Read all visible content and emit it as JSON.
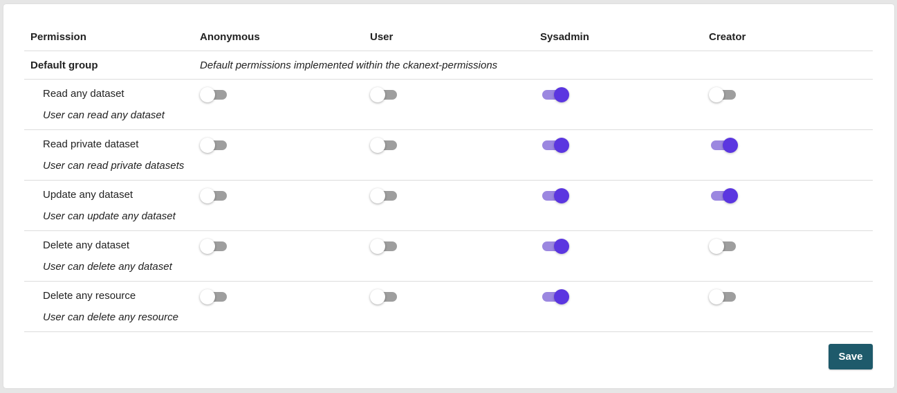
{
  "header": {
    "columns": [
      "Permission",
      "Anonymous",
      "User",
      "Sysadmin",
      "Creator"
    ]
  },
  "group": {
    "name": "Default group",
    "description": "Default permissions implemented within the ckanext-permissions"
  },
  "permissions": [
    {
      "label": "Read any dataset",
      "description": "User can read any dataset",
      "toggles": [
        false,
        false,
        true,
        false
      ]
    },
    {
      "label": "Read private dataset",
      "description": "User can read private datasets",
      "toggles": [
        false,
        false,
        true,
        true
      ]
    },
    {
      "label": "Update any dataset",
      "description": "User can update any dataset",
      "toggles": [
        false,
        false,
        true,
        true
      ]
    },
    {
      "label": "Delete any dataset",
      "description": "User can delete any dataset",
      "toggles": [
        false,
        false,
        true,
        false
      ]
    },
    {
      "label": "Delete any resource",
      "description": "User can delete any resource",
      "toggles": [
        false,
        false,
        true,
        false
      ]
    }
  ],
  "save_label": "Save",
  "colors": {
    "toggle_on_knob": "#5b36e0",
    "toggle_on_track": "#9b87e0",
    "toggle_off_track": "#9e9e9e",
    "save_button": "#1e5a6b"
  },
  "icons": {
    "toggle": "switch-toggle-icon"
  }
}
